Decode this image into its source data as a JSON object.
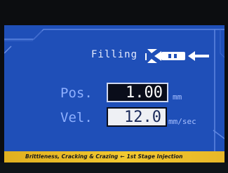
{
  "display": {
    "mode_label": "Filling",
    "mode_icon": "injection-arrow-icon",
    "fields": [
      {
        "label": "Pos.",
        "value": "1.00",
        "unit": "mm"
      },
      {
        "label": "Vel.",
        "value": "12.0",
        "unit": "mm/sec"
      }
    ]
  },
  "caption": {
    "left": "Brittleness, Cracking & Crazing",
    "arrow": "←",
    "right": "1st Stage Injection"
  },
  "colors": {
    "screen": "#1f4fb8",
    "banner": "#f2c830",
    "label": "#8fb0ff"
  }
}
